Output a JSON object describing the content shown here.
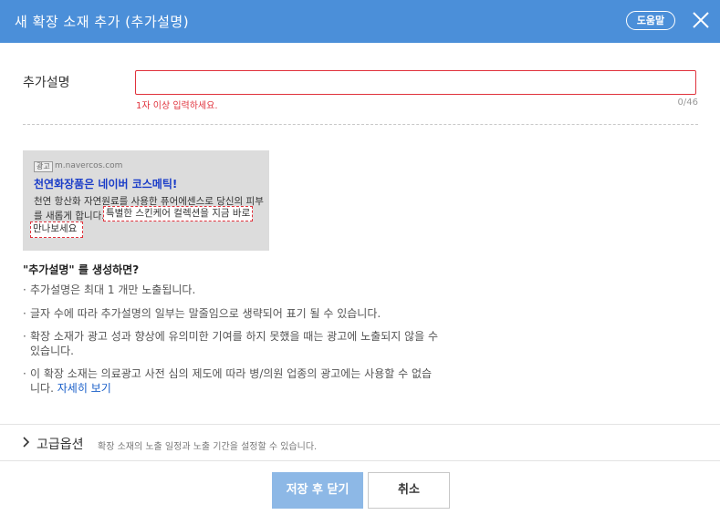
{
  "header": {
    "title": "새 확장 소재 추가 (추가설명)",
    "help_label": "도움말"
  },
  "form": {
    "field_label": "추가설명",
    "input_value": "",
    "error_message": "1자 이상 입력하세요.",
    "char_counter": "0/46"
  },
  "preview": {
    "ad_tag": "광고",
    "url": "m.navercos.com",
    "title": "천연화장품은 네이버 코스메틱!",
    "desc_line1": "천연 항산화 자연원료를 사용한 퓨어에센스로 당신의 피부",
    "desc_line2_prefix": "를 새롭게 합니다.",
    "highlight_1": "특별한 스킨케어 컬렉션을 지금 바로",
    "highlight_2": "만나보세요"
  },
  "info": {
    "heading": "\"추가설명\" 를 생성하면?",
    "bullet_marker": "·",
    "bullets": [
      "추가설명은 최대 1 개만 노출됩니다.",
      "글자 수에 따라 추가설명의 일부는 말줄임으로 생략되어 표기 될 수 있습니다.",
      "확장 소재가 광고 성과 향상에 유의미한 기여를 하지 못했을 때는 광고에 노출되지 않을 수 있습니다.",
      "이 확장 소재는 의료광고 사전 심의 제도에 따라 병/의원 업종의 광고에는 사용할 수 없습니다."
    ],
    "detail_link": "자세히 보기"
  },
  "advanced": {
    "label": "고급옵션",
    "description": "확장 소재의 노출 일정과 노출 기간을 설정할 수 있습니다."
  },
  "footer": {
    "save_label": "저장 후 닫기",
    "cancel_label": "취소"
  },
  "icons": {
    "close": "close-icon",
    "chevron": "chevron-right-icon"
  },
  "colors": {
    "header_bg": "#4b8fd9",
    "error": "#e0323c",
    "link": "#1a5fc8",
    "save_button_bg": "#8db8e6"
  }
}
